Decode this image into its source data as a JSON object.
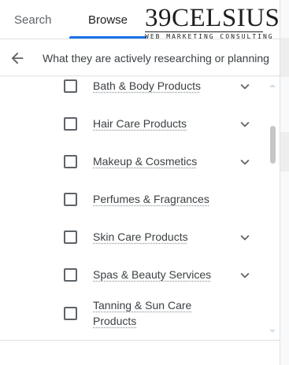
{
  "tabs": {
    "search_label": "Search",
    "browse_label": "Browse"
  },
  "logo": {
    "main": "39CELSIUS",
    "sub": "WEB MARKETING CONSULTING"
  },
  "header": {
    "back_icon": "arrow-back-icon",
    "title": "What they are actively researching or planning"
  },
  "items": [
    {
      "label": "Bath & Body Products",
      "expandable": true,
      "checked": false
    },
    {
      "label": "Hair Care Products",
      "expandable": true,
      "checked": false
    },
    {
      "label": "Makeup & Cosmetics",
      "expandable": true,
      "checked": false
    },
    {
      "label": "Perfumes & Fragrances",
      "expandable": false,
      "checked": false
    },
    {
      "label": "Skin Care Products",
      "expandable": true,
      "checked": false
    },
    {
      "label": "Spas & Beauty Services",
      "expandable": true,
      "checked": false
    },
    {
      "label_line1": "Tanning & Sun Care",
      "label_line2": "Products",
      "expandable": false,
      "checked": false
    }
  ],
  "colors": {
    "accent": "#1a73e8",
    "text": "#3c4043",
    "icon": "#5f6368"
  }
}
